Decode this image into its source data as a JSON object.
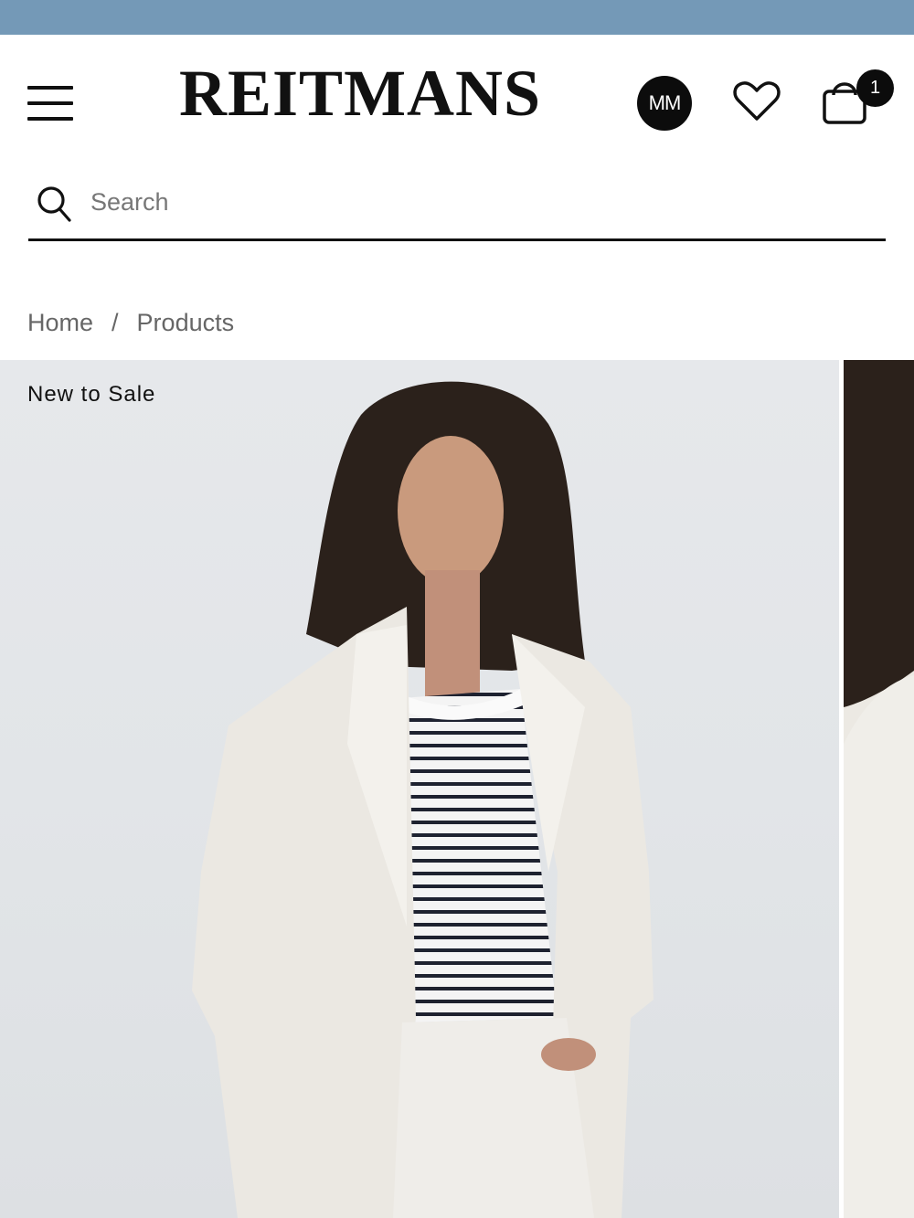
{
  "colors": {
    "top_strip": "#7499b7",
    "text_primary": "#111111",
    "text_muted": "#666666",
    "avatar_bg": "#0c0c0c"
  },
  "header": {
    "logo_text": "REITMANS",
    "avatar_initials": "MM",
    "cart_count": "1",
    "icons": [
      "menu-icon",
      "heart-icon",
      "shopping-bag-icon"
    ]
  },
  "search": {
    "placeholder": "Search",
    "value": ""
  },
  "breadcrumb": {
    "items": [
      {
        "label": "Home"
      },
      {
        "label": "Products"
      }
    ],
    "separator": "/"
  },
  "product": {
    "tag": "New to Sale"
  }
}
